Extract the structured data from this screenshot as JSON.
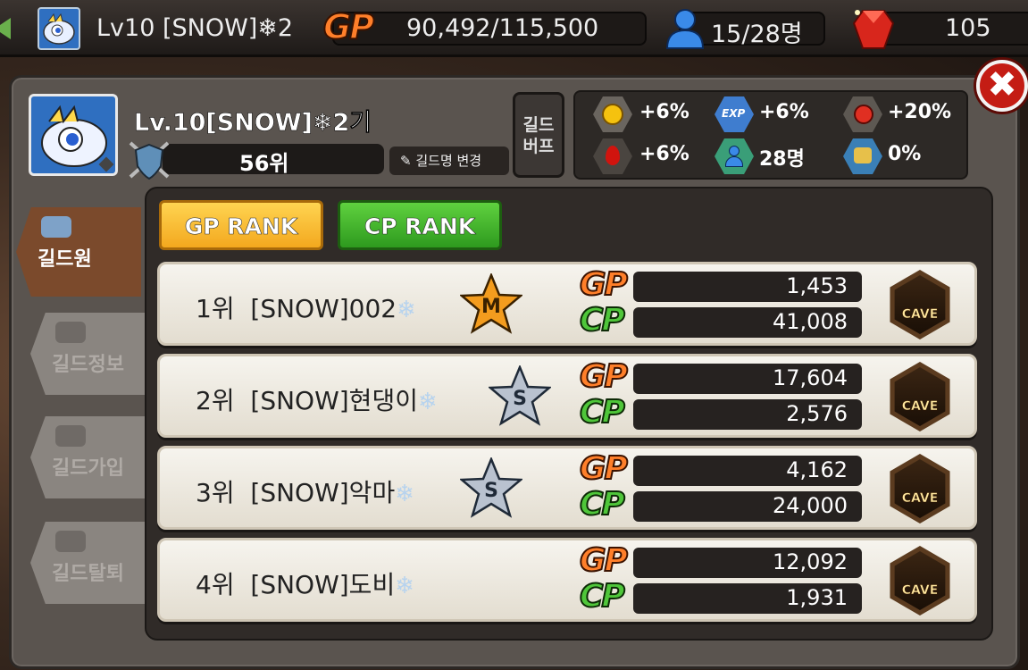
{
  "topbar": {
    "level_name": "Lv10 [SNOW]❄2",
    "gp_logo": "GP",
    "gp_value": "90,492/115,500",
    "members": "15/28명",
    "gems": "105"
  },
  "guild": {
    "name": "Lv.10[SNOW]❄2기",
    "rank": "56위",
    "rename_label": "길드명 변경",
    "buff_label_line1": "길드",
    "buff_label_line2": "버프",
    "buffs": [
      {
        "icon": "gold-coin-icon",
        "value": "+6%"
      },
      {
        "icon": "exp-icon",
        "value": "+6%"
      },
      {
        "icon": "red-gem-icon",
        "value": "+20%"
      },
      {
        "icon": "blood-drop-icon",
        "value": "+6%"
      },
      {
        "icon": "member-icon",
        "value": "28명"
      },
      {
        "icon": "exp-bonus-icon",
        "value": "0%"
      }
    ]
  },
  "sidebar": {
    "items": [
      {
        "label": "길드원",
        "active": true
      },
      {
        "label": "길드정보",
        "active": false
      },
      {
        "label": "길드가입",
        "active": false
      },
      {
        "label": "길드탈퇴",
        "active": false
      }
    ]
  },
  "tabs": {
    "gp_rank": "GP RANK",
    "cp_rank": "CP RANK"
  },
  "rows": [
    {
      "rank": "1위",
      "name": "[SNOW]002",
      "snow": "❄",
      "badge": "M",
      "gp": "1,453",
      "cp": "41,008",
      "cave": "CAVE"
    },
    {
      "rank": "2위",
      "name": "[SNOW]현댕이",
      "snow": "❄",
      "badge": "S",
      "gp": "17,604",
      "cp": "2,576",
      "cave": "CAVE"
    },
    {
      "rank": "3위",
      "name": "[SNOW]악마",
      "snow": "❄",
      "badge": "S",
      "gp": "4,162",
      "cp": "24,000",
      "cave": "CAVE"
    },
    {
      "rank": "4위",
      "name": "[SNOW]도비",
      "snow": "❄",
      "badge": "",
      "gp": "12,092",
      "cp": "1,931",
      "cave": "CAVE"
    }
  ],
  "labels": {
    "gp": "GP",
    "cp": "CP"
  },
  "colors": {
    "gp_orange": "#ff7f2a",
    "cp_green": "#4fc63a",
    "gold_tab": "#f3a81e",
    "green_tab": "#2e9a1e",
    "close_red": "#c41c14"
  }
}
